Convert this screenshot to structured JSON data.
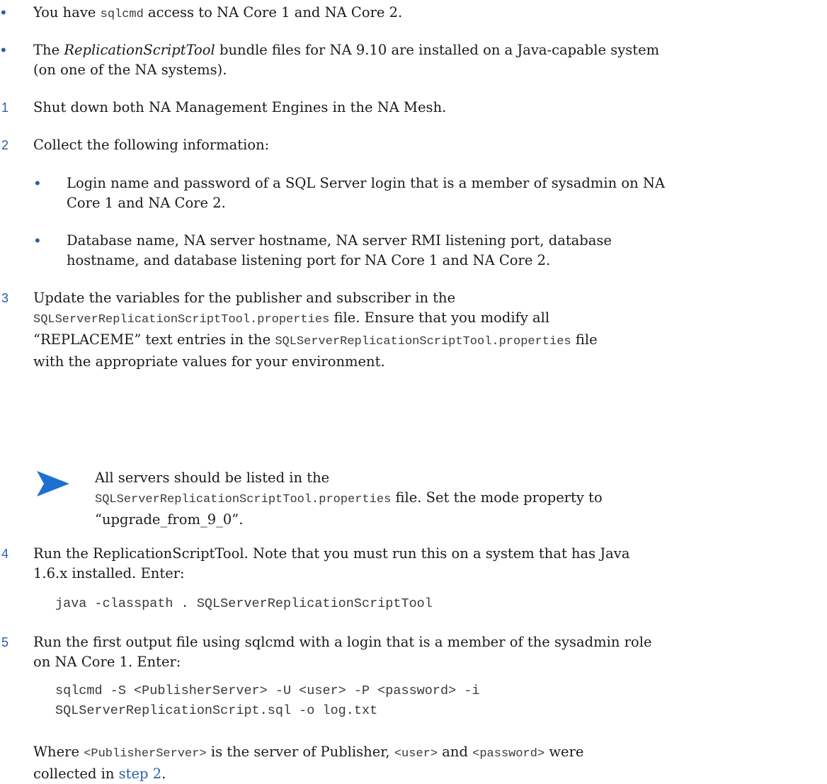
{
  "bullets": {
    "b1": {
      "pre": "You have ",
      "code": "sqlcmd",
      "post": " access to NA Core 1 and NA Core 2."
    },
    "b2": {
      "em": "ReplicationScriptTool",
      "pre": "The ",
      "line1": " bundle files for NA 9.10 are installed on a Java-capable system",
      "line2": "(on one of the NA systems)."
    }
  },
  "steps": {
    "s1": {
      "num": "1",
      "text": "Shut down both NA Management Engines in the NA Mesh."
    },
    "s2": {
      "num": "2",
      "text": "Collect the following information:",
      "sub1_l1": "Login name and password of a SQL Server login that is a member of sysadmin on NA",
      "sub1_l2": "Core 1 and NA Core 2.",
      "sub2_l1": "Database name, NA server hostname, NA server RMI listening port, database",
      "sub2_l2": "hostname, and database listening port for NA Core 1 and NA Core 2."
    },
    "s3": {
      "num": "3",
      "l1": "Update the variables for the publisher and subscriber in the",
      "l2_code": "SQLServerReplicationScriptTool.properties",
      "l2_text": " file. Ensure that you modify all",
      "l3_pre": "“REPLACEME” text entries in the ",
      "l3_code": "SQLServerReplicationScriptTool.properties",
      "l3_post": " file",
      "l4": "with the appropriate values for your environment.",
      "note_l1": "All servers should be listed in the",
      "note_l2_code": "SQLServerReplicationScriptTool.properties",
      "note_l2_text": " file. Set the mode property to",
      "note_l3": "“upgrade_from_9_0”."
    },
    "s4": {
      "num": "4",
      "l1": "Run the ReplicationScriptTool. Note that you must run this on a system that has Java",
      "l2": "1.6.x installed. Enter:",
      "code": "java -classpath . SQLServerReplicationScriptTool"
    },
    "s5": {
      "num": "5",
      "l1": "Run the first output file using sqlcmd with a login that is a member of the sysadmin role",
      "l2": "on NA Core 1. Enter:",
      "code1": "sqlcmd -S <PublisherServer> -U <user> -P <password> -i",
      "code2": "SQLServerReplicationScript.sql -o log.txt",
      "w_pre": "Where ",
      "w_code1": "<PublisherServer>",
      "w_mid1": " is the server of Publisher, ",
      "w_code2": "<user>",
      "w_mid2": " and ",
      "w_code3": "<password>",
      "w_post": " were",
      "w_l2_pre": "collected in ",
      "w_link": "step 2",
      "w_l2_post": "."
    }
  },
  "colors": {
    "accent": "#2a5da8",
    "text": "#1a1a1a"
  }
}
